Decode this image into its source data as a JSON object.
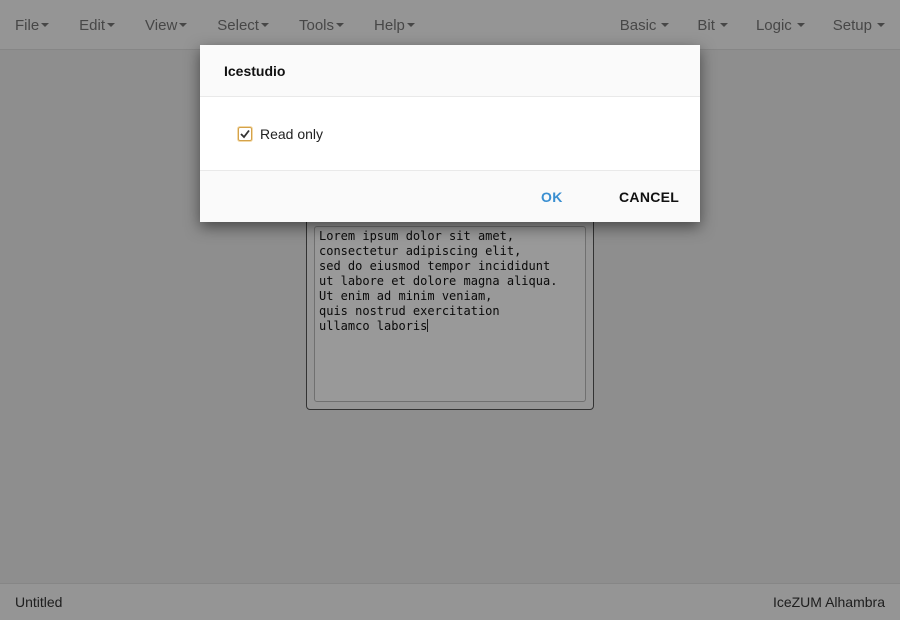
{
  "menubar": {
    "left": [
      {
        "label": "File"
      },
      {
        "label": "Edit"
      },
      {
        "label": "View"
      },
      {
        "label": "Select"
      },
      {
        "label": "Tools"
      },
      {
        "label": "Help"
      }
    ],
    "right": [
      {
        "label": "Basic"
      },
      {
        "label": "Bit"
      },
      {
        "label": "Logic"
      },
      {
        "label": "Setup"
      }
    ]
  },
  "workspace": {
    "memory_block": {
      "text": "Lorem ipsum dolor sit amet,\nconsectetur adipiscing elit,\nsed do eiusmod tempor incididunt\nut labore et dolore magna aliqua.\nUt enim ad minim veniam,\nquis nostrud exercitation\nullamco laboris"
    }
  },
  "footer": {
    "project_name": "Untitled",
    "board_name": "IceZUM Alhambra"
  },
  "dialog": {
    "title": "Icestudio",
    "checkbox": {
      "label": "Read only",
      "checked": true
    },
    "ok_label": "OK",
    "cancel_label": "CANCEL"
  },
  "colors": {
    "ok_button": "#3a8fd1",
    "checkbox_border": "#d4a24a"
  }
}
